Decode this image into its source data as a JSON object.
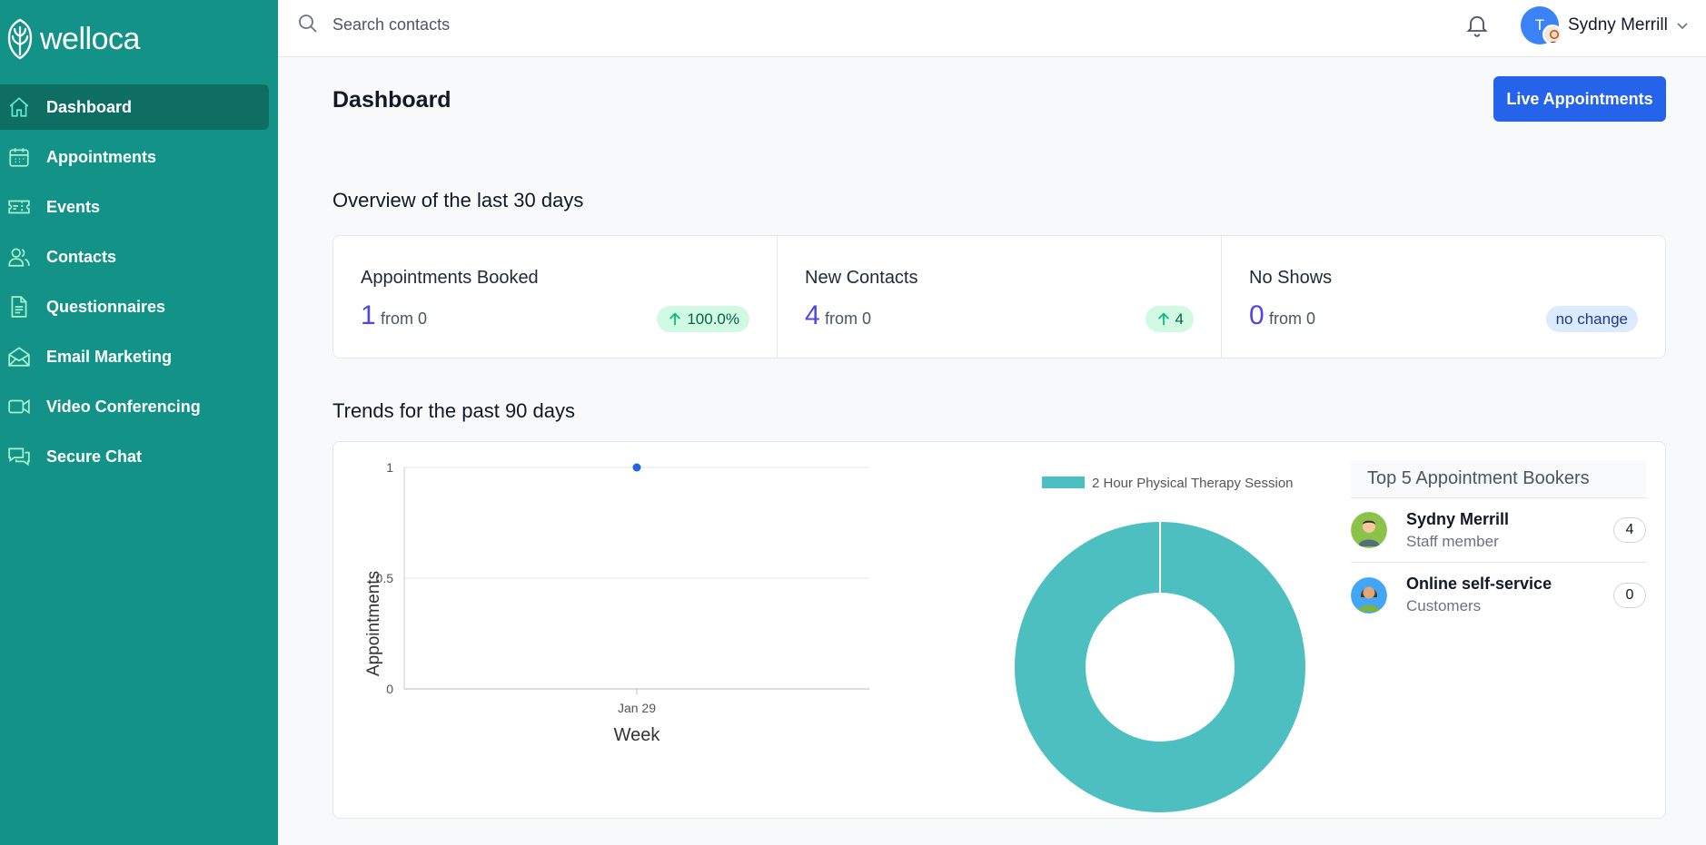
{
  "brand": {
    "name": "welloca",
    "primary": "#139387",
    "accent": "#2563eb"
  },
  "sidebar": {
    "items": [
      {
        "label": "Dashboard",
        "icon": "home-icon",
        "active": true
      },
      {
        "label": "Appointments",
        "icon": "calendar-icon",
        "active": false
      },
      {
        "label": "Events",
        "icon": "ticket-icon",
        "active": false
      },
      {
        "label": "Contacts",
        "icon": "users-icon",
        "active": false
      },
      {
        "label": "Questionnaires",
        "icon": "document-icon",
        "active": false
      },
      {
        "label": "Email Marketing",
        "icon": "envelope-open-icon",
        "active": false
      },
      {
        "label": "Video Conferencing",
        "icon": "video-camera-icon",
        "active": false
      },
      {
        "label": "Secure Chat",
        "icon": "chat-bubbles-icon",
        "active": false
      }
    ]
  },
  "header": {
    "search_placeholder": "Search contacts",
    "user_name": "Sydny Merrill",
    "avatar_initial": "T"
  },
  "main": {
    "title": "Dashboard",
    "live_button": "Live Appointments",
    "overview_title": "Overview of the last 30 days",
    "stats": [
      {
        "label": "Appointments Booked",
        "value": "1",
        "from": "from 0",
        "badge": "100.0%",
        "trend": "up"
      },
      {
        "label": "New Contacts",
        "value": "4",
        "from": "from 0",
        "badge": "4",
        "trend": "up"
      },
      {
        "label": "No Shows",
        "value": "0",
        "from": "from 0",
        "badge": "no change",
        "trend": "none"
      }
    ],
    "trends_title": "Trends for the past 90 days",
    "bookers": {
      "title": "Top 5 Appointment Bookers",
      "items": [
        {
          "name": "Sydny Merrill",
          "role": "Staff member",
          "count": "4"
        },
        {
          "name": "Online self-service",
          "role": "Customers",
          "count": "0"
        }
      ]
    }
  },
  "chart_data": [
    {
      "type": "line",
      "x": [
        "Jan 29"
      ],
      "series": [
        {
          "values": [
            1
          ]
        }
      ],
      "xlabel": "Week",
      "ylabel": "Appointments",
      "yticks": [
        "0",
        "0.5",
        "1"
      ],
      "ylim": [
        0,
        1
      ],
      "grid": true,
      "color": "#2563eb"
    },
    {
      "type": "pie",
      "style": "donut",
      "categories": [
        "2 Hour Physical Therapy Session"
      ],
      "values": [
        1
      ],
      "legend": "top",
      "color": "#4dbfc1"
    }
  ]
}
